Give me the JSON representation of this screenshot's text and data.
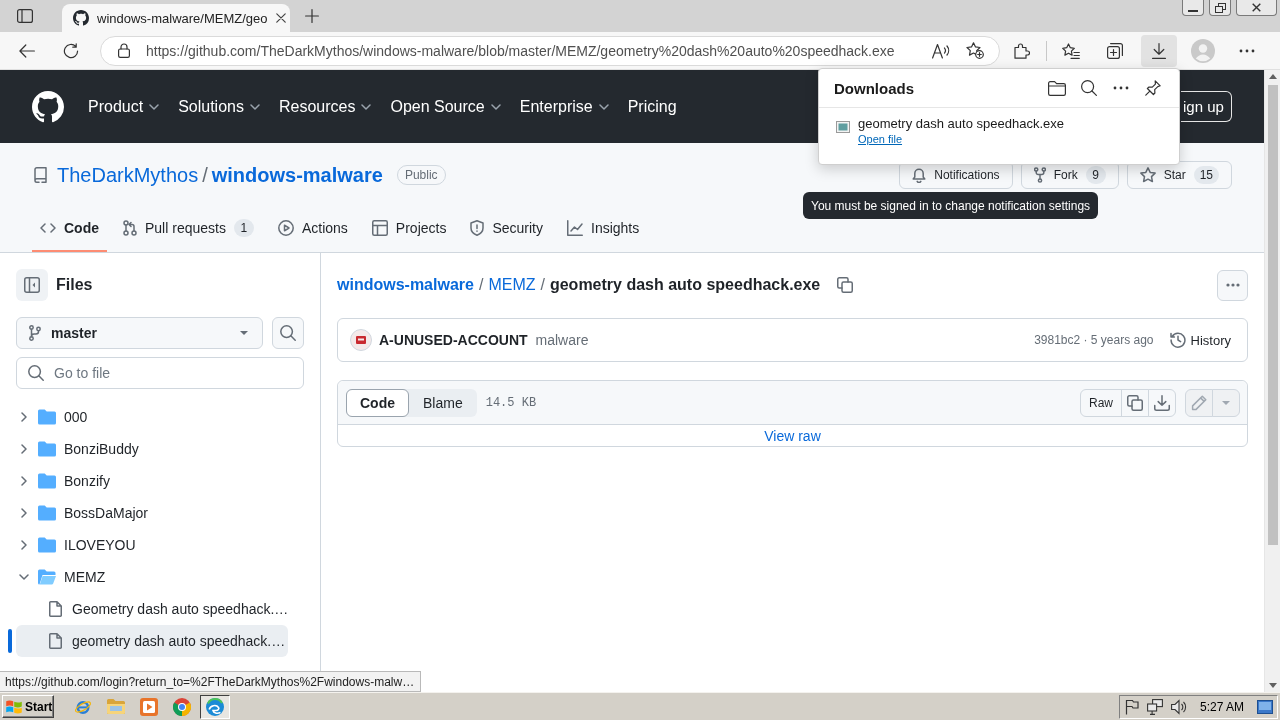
{
  "browser": {
    "tabs": [
      {
        "title": "windows-malware/MEMZ/geo",
        "selected": true
      }
    ],
    "url": "https://github.com/TheDarkMythos/windows-malware/blob/master/MEMZ/geometry%20dash%20auto%20speedhack.exe",
    "status_link": "https://github.com/login?return_to=%2FTheDarkMythos%2Fwindows-malw…"
  },
  "downloads_panel": {
    "open": true,
    "title": "Downloads",
    "items": [
      {
        "file_name": "geometry dash auto speedhack.exe",
        "action": "Open file"
      }
    ]
  },
  "header": {
    "nav": [
      {
        "label": "Product",
        "has_menu": true
      },
      {
        "label": "Solutions",
        "has_menu": true
      },
      {
        "label": "Resources",
        "has_menu": true
      },
      {
        "label": "Open Source",
        "has_menu": true
      },
      {
        "label": "Enterprise",
        "has_menu": true
      },
      {
        "label": "Pricing",
        "has_menu": false
      }
    ],
    "sign_up": "ign up"
  },
  "repo": {
    "owner": "TheDarkMythos",
    "separator": "/",
    "name": "windows-malware",
    "visibility": "Public",
    "actions": [
      {
        "label": "Notifications"
      },
      {
        "label": "Fork",
        "count": "9"
      },
      {
        "label": "Star",
        "count": "15"
      }
    ],
    "tooltip": "You must be signed in to change notification settings",
    "tabs": [
      {
        "label": "Code",
        "selected": true
      },
      {
        "label": "Pull requests",
        "count": "1",
        "selected": false
      },
      {
        "label": "Actions",
        "selected": false
      },
      {
        "label": "Projects",
        "selected": false
      },
      {
        "label": "Security",
        "selected": false
      },
      {
        "label": "Insights",
        "selected": false
      }
    ]
  },
  "sidebar": {
    "title": "Files",
    "branch": "master",
    "file_search": {
      "placeholder": "Go to file"
    },
    "tree": [
      {
        "kind": "folder",
        "name": "000",
        "expanded": false,
        "selected": false
      },
      {
        "kind": "folder",
        "name": "BonziBuddy",
        "expanded": false,
        "selected": false
      },
      {
        "kind": "folder",
        "name": "Bonzify",
        "expanded": false,
        "selected": false
      },
      {
        "kind": "folder",
        "name": "BossDaMajor",
        "expanded": false,
        "selected": false
      },
      {
        "kind": "folder",
        "name": "ILOVEYOU",
        "expanded": false,
        "selected": false
      },
      {
        "kind": "folder",
        "name": "MEMZ",
        "expanded": true,
        "selected": false,
        "children": [
          {
            "kind": "file",
            "name": "Geometry dash auto speedhack.…",
            "selected": false
          },
          {
            "kind": "file",
            "name": "geometry dash auto speedhack.…",
            "selected": true
          }
        ]
      }
    ]
  },
  "file_view": {
    "breadcrumb": [
      {
        "kind": "repo",
        "label": "windows-malware",
        "separator": "/"
      },
      {
        "kind": "folder",
        "label": "MEMZ",
        "separator": "/"
      },
      {
        "kind": "file",
        "label": "geometry dash auto speedhack.exe"
      }
    ],
    "commit": {
      "author": "A-UNUSED-ACCOUNT",
      "message": "malware",
      "meta": "3981bc2 · 5 years ago",
      "history": "History"
    },
    "file": {
      "views": [
        {
          "label": "Code",
          "selected": true
        },
        {
          "label": "Blame",
          "selected": false
        }
      ],
      "size": "14.5 KB",
      "raw": "Raw",
      "edit": {
        "disabled": true
      },
      "view_raw": "View raw"
    }
  },
  "taskbar": {
    "start": "Start",
    "apps": [
      {
        "selected": false
      },
      {
        "selected": false
      },
      {
        "selected": false
      },
      {
        "selected": false
      },
      {
        "selected": true
      }
    ],
    "clock": "5:27 AM"
  }
}
